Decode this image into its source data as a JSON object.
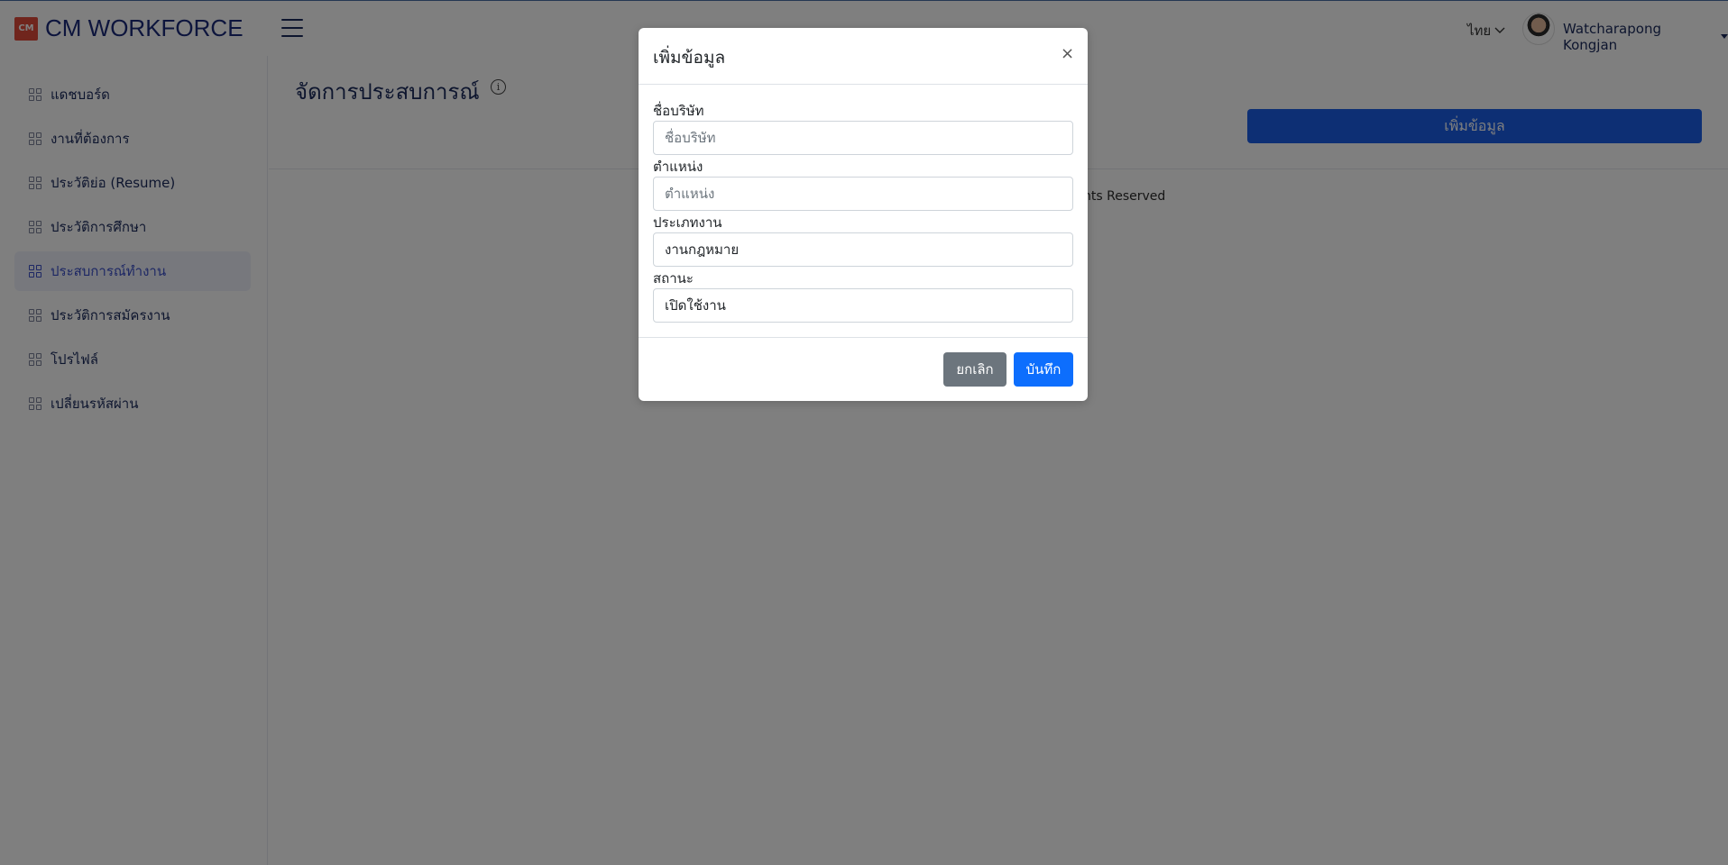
{
  "app": {
    "logo_badge": "CM",
    "logo_text": "CM WORKFORCE"
  },
  "header": {
    "language": "ไทย",
    "username": "Watcharapong Kongjan"
  },
  "sidebar": {
    "items": [
      {
        "label": "แดชบอร์ด"
      },
      {
        "label": "งานที่ต้องการ"
      },
      {
        "label": "ประวัติย่อ (Resume)"
      },
      {
        "label": "ประวัติการศึกษา"
      },
      {
        "label": "ประสบการณ์ทำงาน",
        "active": true
      },
      {
        "label": "ประวัติการสมัครงาน"
      },
      {
        "label": "โปรไฟล์"
      },
      {
        "label": "เปลี่ยนรหัสผ่าน"
      }
    ]
  },
  "main": {
    "title": "จัดการประสบการณ์",
    "add_button": "เพิ่มข้อมูล",
    "footer_visible": "hts Reserved"
  },
  "modal": {
    "title": "เพิ่มข้อมูล",
    "close": "×",
    "fields": {
      "company": {
        "label": "ชื่อบริษัท",
        "placeholder": "ชื่อบริษัท",
        "value": ""
      },
      "position": {
        "label": "ตำแหน่ง",
        "placeholder": "ตำแหน่ง",
        "value": ""
      },
      "job_type": {
        "label": "ประเภทงาน",
        "value": "งานกฎหมาย"
      },
      "status": {
        "label": "สถานะ",
        "value": "เปิดใช้งาน"
      }
    },
    "cancel_label": "ยกเลิก",
    "save_label": "บันทึก"
  },
  "colors": {
    "primary": "#1b5ee8",
    "save": "#0d6efd",
    "cancel": "#6c757d",
    "active_nav": "#3a4fc8",
    "logo_badge": "#e04a3a"
  }
}
